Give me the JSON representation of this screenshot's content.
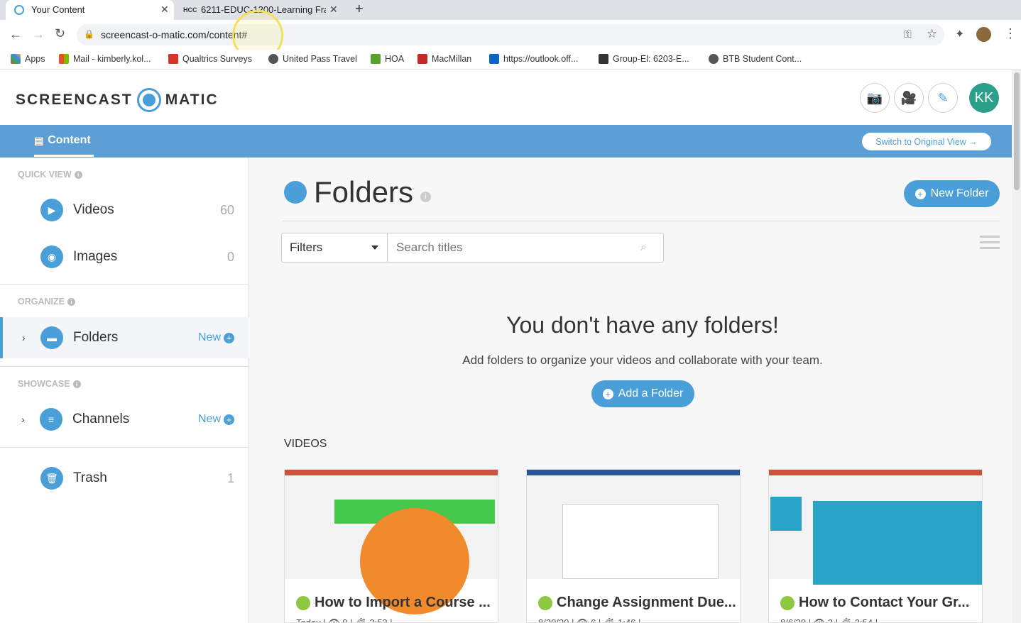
{
  "browser": {
    "tabs": [
      {
        "title": "Your Content",
        "active": true
      },
      {
        "title": "6211-EDUC-1200-Learning Fra",
        "active": false
      }
    ],
    "url": "screencast-o-matic.com/content#",
    "bookmarks": [
      "Apps",
      "Mail - kimberly.kol...",
      "Qualtrics Surveys",
      "United Pass Travel",
      "HOA",
      "MacMillan",
      "https://outlook.off...",
      "Group-El: 6203-E...",
      "BTB Student Cont..."
    ]
  },
  "header": {
    "logo_left": "SCREENCAST",
    "logo_right": "MATIC",
    "avatar": "KK",
    "brand_color": "#4a9fd8"
  },
  "nav": {
    "content_label": "Content",
    "switch_label": "Switch to Original View →"
  },
  "sidebar": {
    "quick_view": "QUICK VIEW",
    "organize": "ORGANIZE",
    "showcase": "SHOWCASE",
    "videos_label": "Videos",
    "videos_count": "60",
    "images_label": "Images",
    "images_count": "0",
    "folders_label": "Folders",
    "channels_label": "Channels",
    "new_label": "New",
    "trash_label": "Trash",
    "trash_count": "1"
  },
  "main": {
    "title": "Folders",
    "new_folder": "New Folder",
    "filters": "Filters",
    "search_placeholder": "Search titles",
    "empty_heading": "You don't have any folders!",
    "empty_text": "Add folders to organize your videos and collaborate with your team.",
    "add_folder": "Add a Folder",
    "videos_section": "VIDEOS",
    "cards": [
      {
        "title": "How to Import a Course ...",
        "meta": "Today  |  👁 0  |  ⏱ 2:52  |"
      },
      {
        "title": "Change Assignment Due...",
        "meta": "8/20/20  |  👁 6  |  ⏱ 1:46  |"
      },
      {
        "title": "How to Contact Your Gr...",
        "meta": "8/6/20  |  👁 3  |  ⏱ 3:54  |"
      }
    ]
  }
}
